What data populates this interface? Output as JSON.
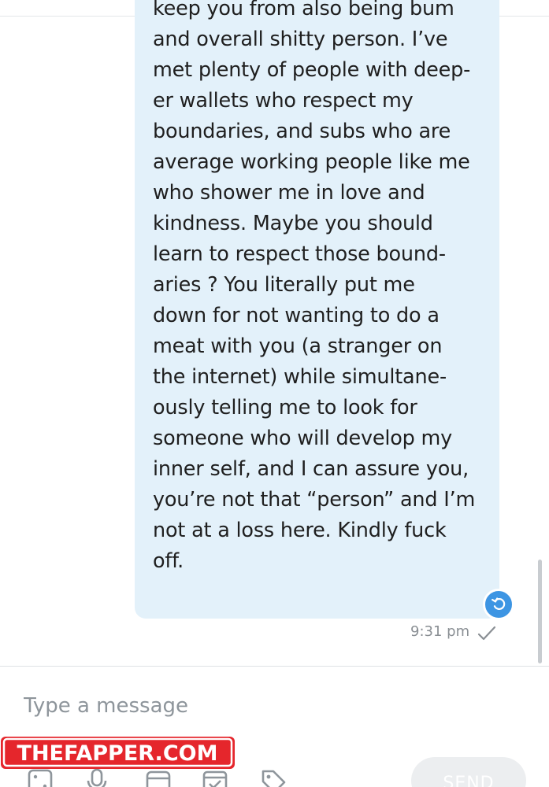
{
  "message": {
    "lines": [
      "keep you from also being bum",
      "and overall shitty person. I’ve",
      "met plenty of people with deep-",
      "er wallets who respect my",
      "boundaries, and subs who are",
      "average working people like me",
      "who shower me in love and",
      "kindness. Maybe you should",
      "learn to respect those bound-",
      "aries ? You literally put me",
      "down for not wanting to do a",
      "meat with you (a stranger on",
      "the internet) while simultane-",
      "ously telling me to look for",
      "someone who will develop my",
      "inner self, and I can assure you,",
      "you’re not that “person” and I’m",
      "not at a loss here. Kindly fuck",
      "off."
    ],
    "time": "9:31 pm",
    "status_icon": "check-icon",
    "reply_icon": "reply-icon",
    "bubble_color": "#e3f1fa"
  },
  "composer": {
    "placeholder": "Type a message",
    "value": "",
    "toolbar_icons": [
      "dice-icon",
      "microphone-icon",
      "tip-icon",
      "schedule-icon",
      "price-tag-icon"
    ],
    "send_label": "SEND"
  },
  "watermark": {
    "text": "THEFAPPER.COM",
    "color": "#e5262c"
  }
}
